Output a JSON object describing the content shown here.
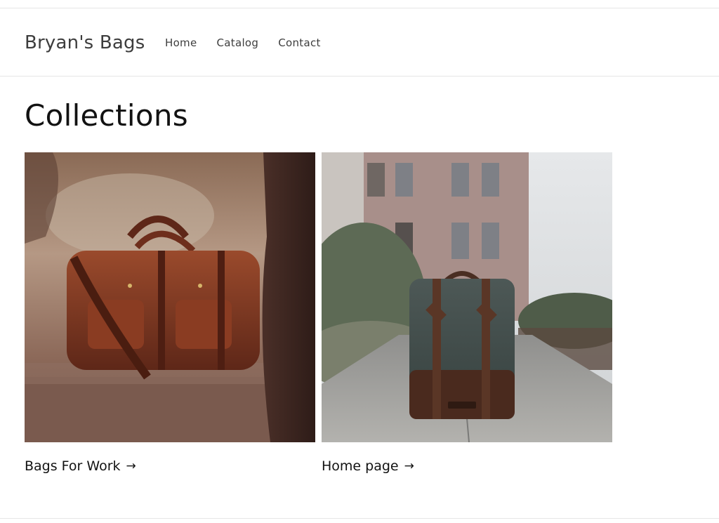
{
  "header": {
    "logo": "Bryan's Bags",
    "nav": [
      {
        "label": "Home"
      },
      {
        "label": "Catalog"
      },
      {
        "label": "Contact"
      }
    ]
  },
  "main": {
    "title": "Collections",
    "collections": [
      {
        "label": "Bags For Work",
        "arrow": "→",
        "image": "leather-duffel-bag-photo"
      },
      {
        "label": "Home page",
        "arrow": "→",
        "image": "canvas-backpack-photo"
      }
    ]
  },
  "colors": {
    "text": "#121212",
    "nav_text": "#3d3d3d",
    "divider": "#e6e6e6",
    "background": "#ffffff"
  }
}
